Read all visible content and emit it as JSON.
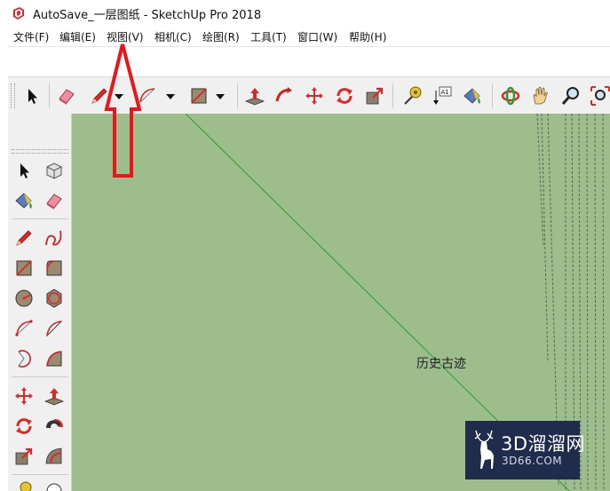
{
  "window": {
    "title": "AutoSave_一层图纸 - SketchUp Pro 2018"
  },
  "menu": [
    "文件(F)",
    "编辑(E)",
    "视图(V)",
    "相机(C)",
    "绘图(R)",
    "工具(T)",
    "窗口(W)",
    "帮助(H)"
  ],
  "toolbar": {
    "icons": [
      "select-icon",
      "eraser-icon",
      "pencil-icon",
      "arc-icon",
      "rectangle-icon",
      "push-pull-icon",
      "follow-me-icon",
      "move-icon",
      "rotate-icon",
      "scale-icon",
      "tape-measure-icon",
      "text-icon",
      "paint-bucket-icon",
      "orbit-icon",
      "pan-icon",
      "zoom-icon",
      "zoom-extents-icon"
    ]
  },
  "left_tools": [
    "select-icon",
    "component-icon",
    "paint-bucket-icon",
    "eraser-icon",
    "pencil-icon",
    "freehand-icon",
    "rectangle-icon",
    "rotated-rectangle-icon",
    "circle-icon",
    "polygon-icon",
    "arc-icon",
    "pie-icon",
    "three-point-arc-icon",
    "two-point-arc-icon",
    "move-icon",
    "push-pull-icon",
    "rotate-icon",
    "follow-me-icon",
    "scale-icon",
    "offset-icon"
  ],
  "viewport": {
    "label": "历史古迹",
    "background_color": "#9dbd8d",
    "edge_color": "#2f9a2f"
  },
  "watermark": {
    "main": "3D溜溜网",
    "sub": "3D66.COM"
  },
  "annotation": {
    "color": "#e8161b",
    "target": "视图(V)"
  }
}
